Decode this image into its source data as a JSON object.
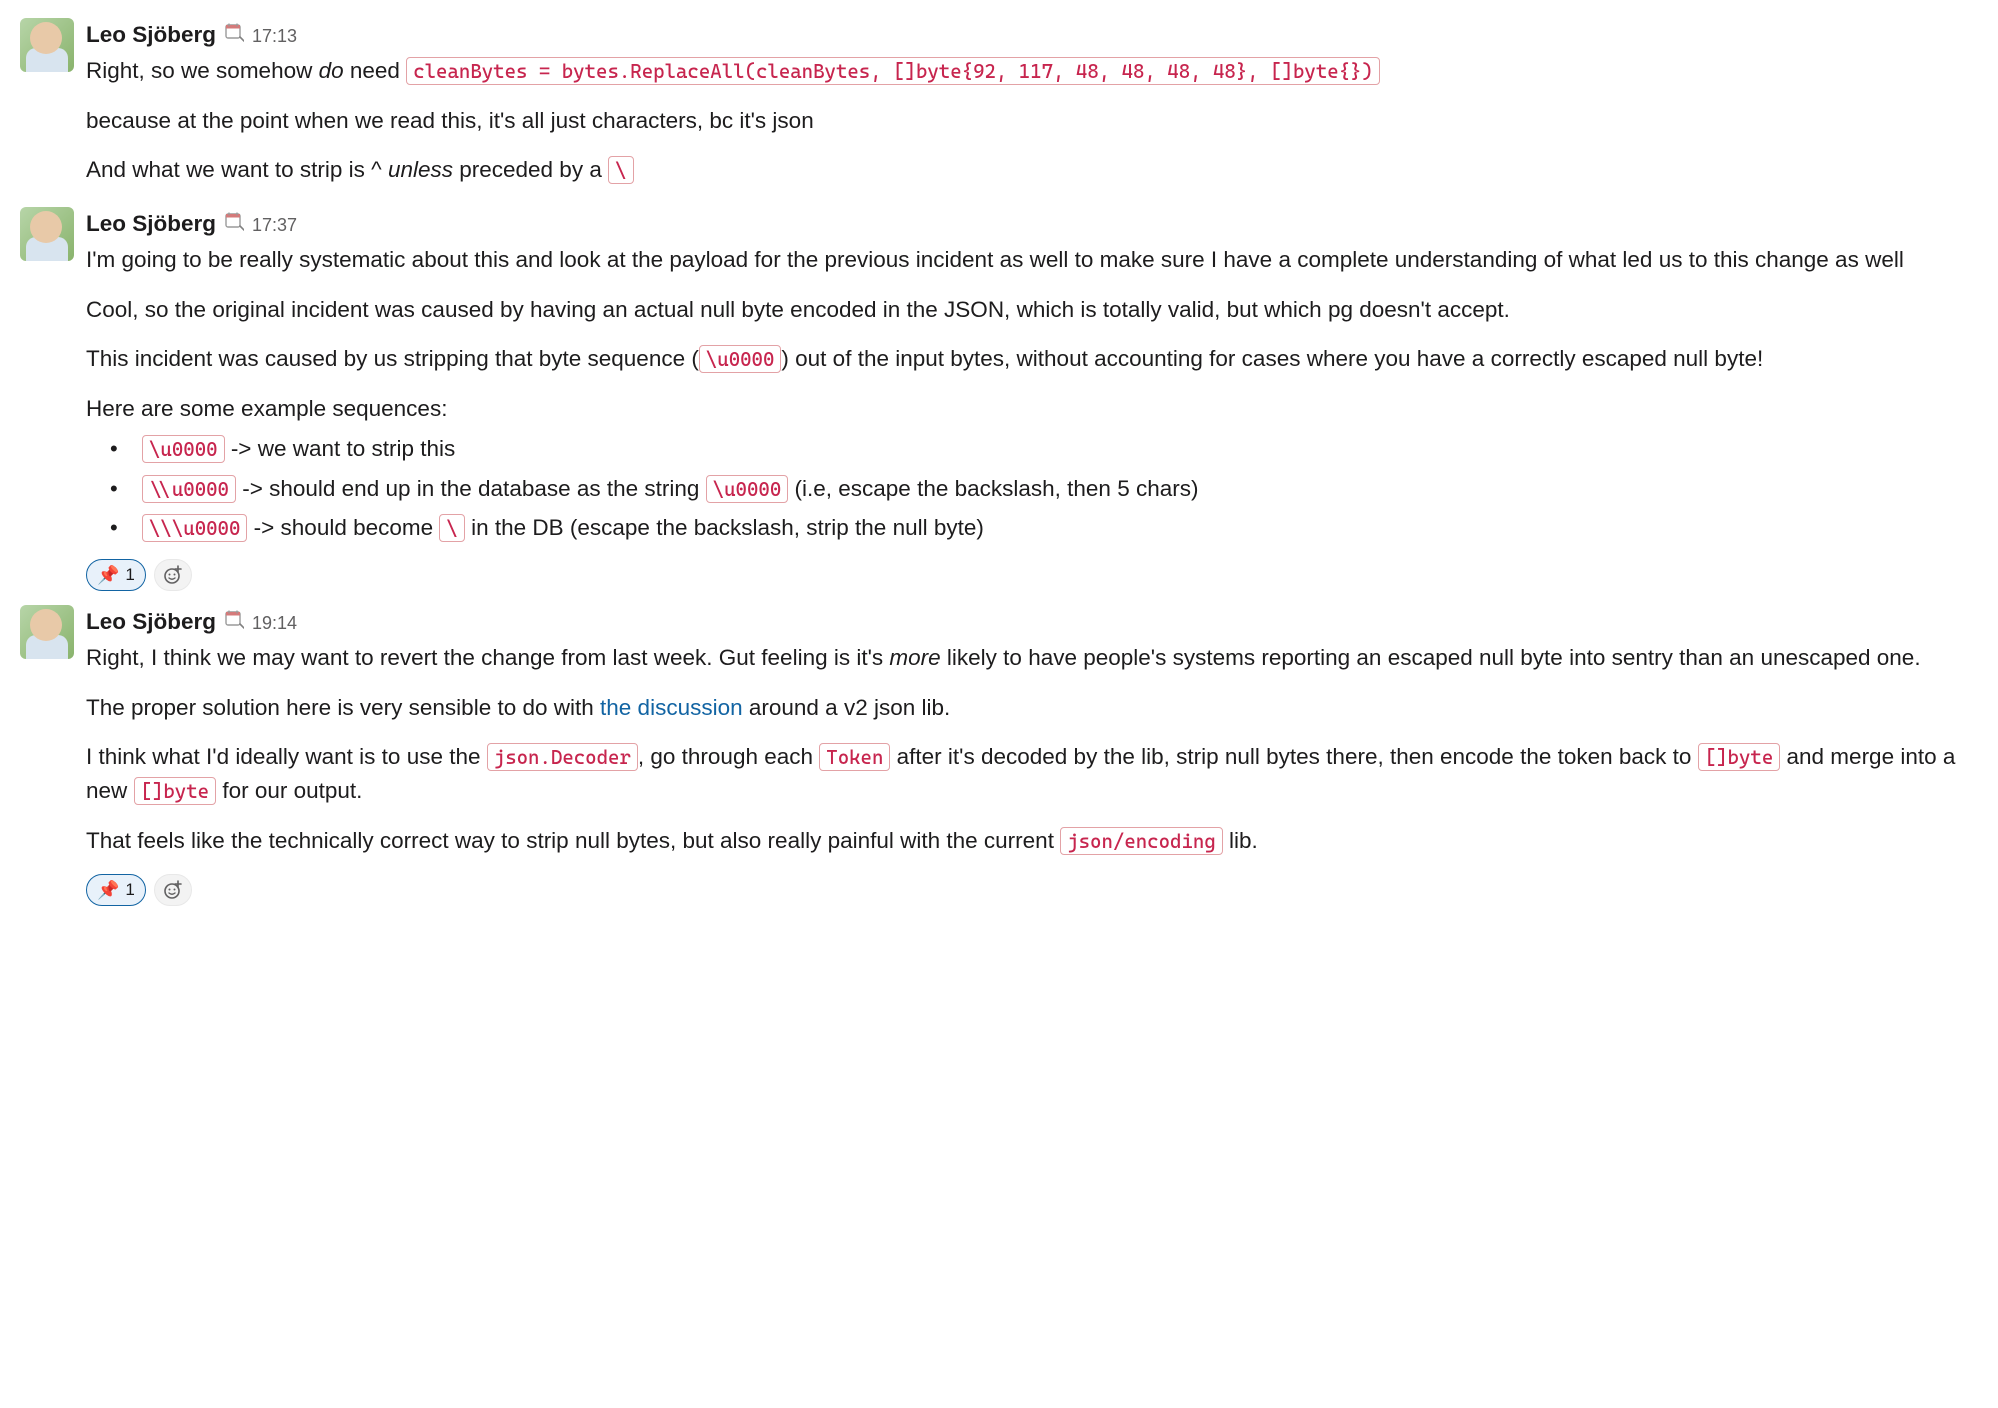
{
  "messages": [
    {
      "author": "Leo Sjöberg",
      "timestamp": "17:13",
      "p1_pre": "Right, so we somehow ",
      "p1_em": "do",
      "p1_mid": " need ",
      "p1_code": "cleanBytes = bytes.ReplaceAll(cleanBytes, []byte{92, 117, 48, 48, 48, 48}, []byte{})",
      "p2": "because at the point when we read this, it's all just characters, bc it's json",
      "p3_pre": "And what we want to strip is ^ ",
      "p3_em": "unless",
      "p3_mid": " preceded by a ",
      "p3_code": "\\"
    },
    {
      "author": "Leo Sjöberg",
      "timestamp": "17:37",
      "p1": "I'm going to be really systematic about this and look at the payload for the previous incident as well to make sure I have a complete understanding of what led us to this change as well",
      "p2": "Cool, so the original incident was caused by having an actual null byte encoded in the JSON, which is totally valid, but which pg doesn't accept.",
      "p3_pre": "This incident was caused by us stripping that byte sequence (",
      "p3_code": "\\u0000",
      "p3_post": ") out of the input bytes, without accounting for cases where you have a correctly escaped null byte!",
      "p4": "Here are some example sequences:",
      "li1_code": "\\u0000",
      "li1_post": " -> we want to strip this",
      "li2_code": "\\\\u0000",
      "li2_mid": " -> should end up in the database as the string ",
      "li2_code2": "\\u0000",
      "li2_post": " (i.e, escape the backslash, then 5 chars)",
      "li3_code": "\\\\\\u0000",
      "li3_mid": " -> should become ",
      "li3_code2": "\\",
      "li3_post": " in the DB (escape the backslash, strip the null byte)",
      "reaction_emoji": "📌",
      "reaction_count": "1"
    },
    {
      "author": "Leo Sjöberg",
      "timestamp": "19:14",
      "p1_pre": "Right, I think we may want to revert the change from last week. Gut feeling is it's ",
      "p1_em": "more",
      "p1_post": " likely to have people's systems reporting an escaped null byte into sentry than an unescaped one.",
      "p2_pre": "The proper solution here is very sensible to do with ",
      "p2_link": "the discussion",
      "p2_post": " around a v2 json lib.",
      "p3_pre": "I think what I'd ideally want is to use the ",
      "p3_code1": "json.Decoder",
      "p3_mid1": ", go through each ",
      "p3_code2": "Token",
      "p3_mid2": " after it's decoded by the lib, strip null bytes there, then encode the token back to ",
      "p3_code3": "[]byte",
      "p3_mid3": " and merge into a new ",
      "p3_code4": "[]byte",
      "p3_post": " for our output.",
      "p4_pre": "That feels like the technically correct way to strip null bytes, but also really painful with the current ",
      "p4_code": "json/encoding",
      "p4_post": " lib.",
      "reaction_emoji": "📌",
      "reaction_count": "1"
    }
  ]
}
